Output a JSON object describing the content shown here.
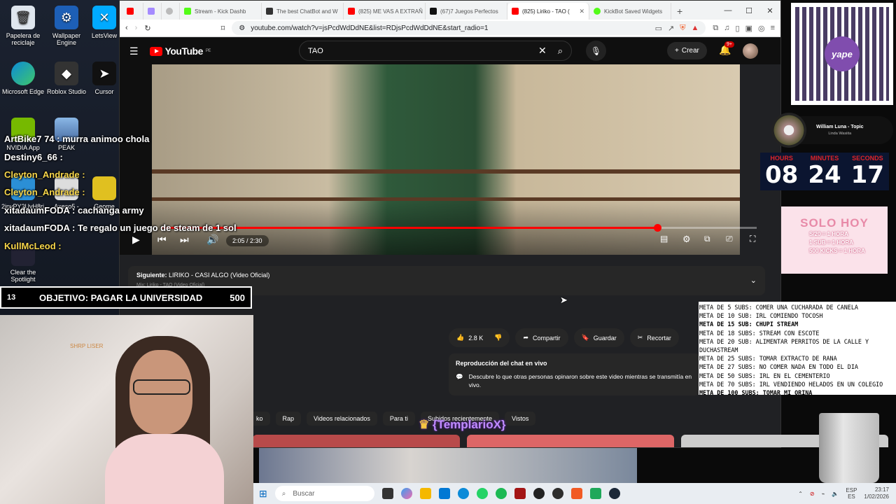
{
  "desktop": {
    "icons": [
      {
        "label": "Papelera de reciclaje"
      },
      {
        "label": "Wallpaper Engine"
      },
      {
        "label": "LetsView"
      },
      {
        "label": "Microsoft Edge"
      },
      {
        "label": "Roblox Studio"
      },
      {
        "label": "Cursor"
      },
      {
        "label": "NVIDIA App"
      },
      {
        "label": "PEAK"
      },
      {
        "label": "2invPY2UvH8ri..."
      },
      {
        "label": "Axeso5 -"
      },
      {
        "label": "Geome"
      },
      {
        "label": "Clear the Spotlight"
      }
    ]
  },
  "browser": {
    "tabs": [
      {
        "label": "Stream - Kick Dashb",
        "color": "#53fc18"
      },
      {
        "label": "The best ChatBot and W",
        "color": "#333333"
      },
      {
        "label": "(825) ME VAS A EXTRAÑ",
        "color": "#ff0000"
      },
      {
        "label": "(67)7 Juegos Perfectos",
        "color": "#111111"
      },
      {
        "label": "(825) Liriko - TAO (",
        "color": "#ff0000"
      },
      {
        "label": "KickBot Saved Widgets",
        "color": "#53fc18"
      }
    ],
    "url": "youtube.com/watch?v=jsPcdWdDdNE&list=RDjsPcdWdDdNE&start_radio=1"
  },
  "youtube": {
    "logo_text": "YouTube",
    "region": "PE",
    "search_value": "TAO",
    "create_label": "Crear",
    "notif_count": "9+",
    "time": "2:05 / 2:30",
    "progress": 0.833,
    "next_label": "Siguiente:",
    "next_title": "LIRIKO - CASI ALGO (Video Oficial)",
    "next_sub": "Mix: Liriko - TAO (Video Oficial)",
    "likes": "2.8 K",
    "share": "Compartir",
    "save": "Guardar",
    "clip": "Recortar",
    "chat_replay_title": "Reproducción del chat en vivo",
    "chat_replay_desc": "Descubre lo que otras personas opinaron sobre este video mientras se transmitía en vivo.",
    "chips": [
      "ko",
      "Rap",
      "Videos relacionados",
      "Para ti",
      "Subidos recientemente",
      "Vistos"
    ]
  },
  "stream_chat": [
    {
      "text": "ArtBike7 74 : murra animoo chola"
    },
    {
      "text": "Destiny6_66 :"
    },
    {
      "text": "Cleyton_Andrade :"
    },
    {
      "text": "Cleyton_Andrade :"
    },
    {
      "text": "xitadaumFODA : cachanga army"
    },
    {
      "text": "xitadaumFODA : Te regalo un juego de steam de 1 sol"
    },
    {
      "text": "KullMcLeod :"
    }
  ],
  "goal": {
    "count": "13",
    "title": "OBJETIVO: PAGAR LA UNIVERSIDAD",
    "target": "500"
  },
  "qr": {
    "brand": "yape"
  },
  "now_playing": {
    "title": "William Luna - Topic",
    "subtitle": "Linda Wasiita"
  },
  "timer": {
    "hours_label": "HOURS",
    "hours": "08",
    "minutes_label": "MINUTES",
    "minutes": "24",
    "seconds_label": "SECONDS",
    "seconds": "17"
  },
  "promo": {
    "title": "SOLO HOY",
    "lines": [
      "S/20 = 1 HORA",
      "1 SUB = 1 HORA",
      "500 KICKS = 1 HORA"
    ]
  },
  "metas": [
    {
      "text": "META DE 5 SUBS: COMER UNA CUCHARADA DE CANELA",
      "bold": false
    },
    {
      "text": "META DE 10 SUB: IRL COMIENDO TOCOSH",
      "bold": false
    },
    {
      "text": "META DE 15 SUB: CHUPI STREAM",
      "bold": true
    },
    {
      "text": "META DE 18 SUBS: STREAM CON ESCOTE",
      "bold": false
    },
    {
      "text": "META DE 20 SUB:  ALIMENTAR PERRITOS DE LA CALLE Y DUCHASTREAM",
      "bold": false
    },
    {
      "text": "META DE 25 SUBS: TOMAR EXTRACTO DE RANA",
      "bold": false
    },
    {
      "text": "META DE 27 SUBS: NO COMER NADA EN TODO EL DIA",
      "bold": false
    },
    {
      "text": "META DE 50 SUBS: IRL EN EL CEMENTERIO",
      "bold": false
    },
    {
      "text": "META DE 70 SUBS: IRL VENDIENDO HELADOS EN UN COLEGIO",
      "bold": false
    },
    {
      "text": "META DE 100 SUBS: TOMAR MI ORINA",
      "bold": true
    }
  ],
  "templario": "{TemplarioX}",
  "webcam_text": "SHRP LISER",
  "taskbar": {
    "search_placeholder": "Buscar",
    "lang": "ESP",
    "lang2": "ES",
    "time": "23:17",
    "date": "1/02/2026"
  }
}
